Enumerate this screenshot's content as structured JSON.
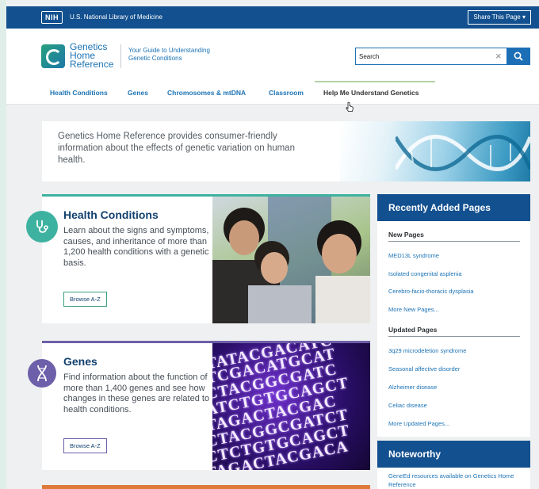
{
  "topbar": {
    "org_logo": "NIH",
    "org_name": "U.S. National Library of Medicine",
    "share_label": "Share This Page ▾"
  },
  "header": {
    "logo_lines": [
      "Genetics",
      "Home",
      "Reference"
    ],
    "tagline": "Your Guide to Understanding Genetic Conditions",
    "search": {
      "value": "Search",
      "clear_icon": "×"
    }
  },
  "nav": {
    "items": [
      {
        "label": "Health Conditions"
      },
      {
        "label": "Genes"
      },
      {
        "label": "Chromosomes & mtDNA"
      },
      {
        "label": "Classroom"
      },
      {
        "label": "Help Me Understand Genetics"
      }
    ],
    "active_index": 4
  },
  "intro": {
    "text": "Genetics Home Reference provides consumer-friendly information about the effects of genetic variation on human health."
  },
  "cards": {
    "health": {
      "title": "Health Conditions",
      "description": "Learn about the signs and symptoms, causes, and inheritance of more than 1,200 health conditions with a genetic basis.",
      "button": "Browse A-Z",
      "accent": "#3eb2a0"
    },
    "genes": {
      "title": "Genes",
      "description": "Find information about the function of more than 1,400 genes and see how changes in these genes are related to health conditions.",
      "button": "Browse A-Z",
      "accent": "#6d5fa9",
      "dna_lines": [
        "TATACGACATC",
        "TCGACATGCAT",
        "CTACGGCGATC",
        "ATCTGTGCAGCT",
        "TAGACTACGAC",
        "CTACGGCGATCT",
        "CTCTGTGCAGCT",
        "TAGACTACGACA"
      ]
    }
  },
  "sidebar": {
    "title": "Recently Added Pages",
    "new_pages_heading": "New Pages",
    "new_pages": [
      "MED13L syndrome",
      "Isolated congenital asplenia",
      "Cerebro-facio-thoracic dysplasia",
      "More New Pages..."
    ],
    "updated_heading": "Updated Pages",
    "updated_pages": [
      "3q29 microdeletion syndrome",
      "Seasonal affective disorder",
      "Alzheimer disease",
      "Celiac disease",
      "More Updated Pages..."
    ]
  },
  "noteworthy": {
    "title": "Noteworthy",
    "text": "GeneEd resources available on Genetics Home Reference"
  },
  "colors": {
    "brand_blue": "#12508f",
    "link_blue": "#1c73b5",
    "teal": "#3eb2a0",
    "purple": "#6d5fa9"
  }
}
